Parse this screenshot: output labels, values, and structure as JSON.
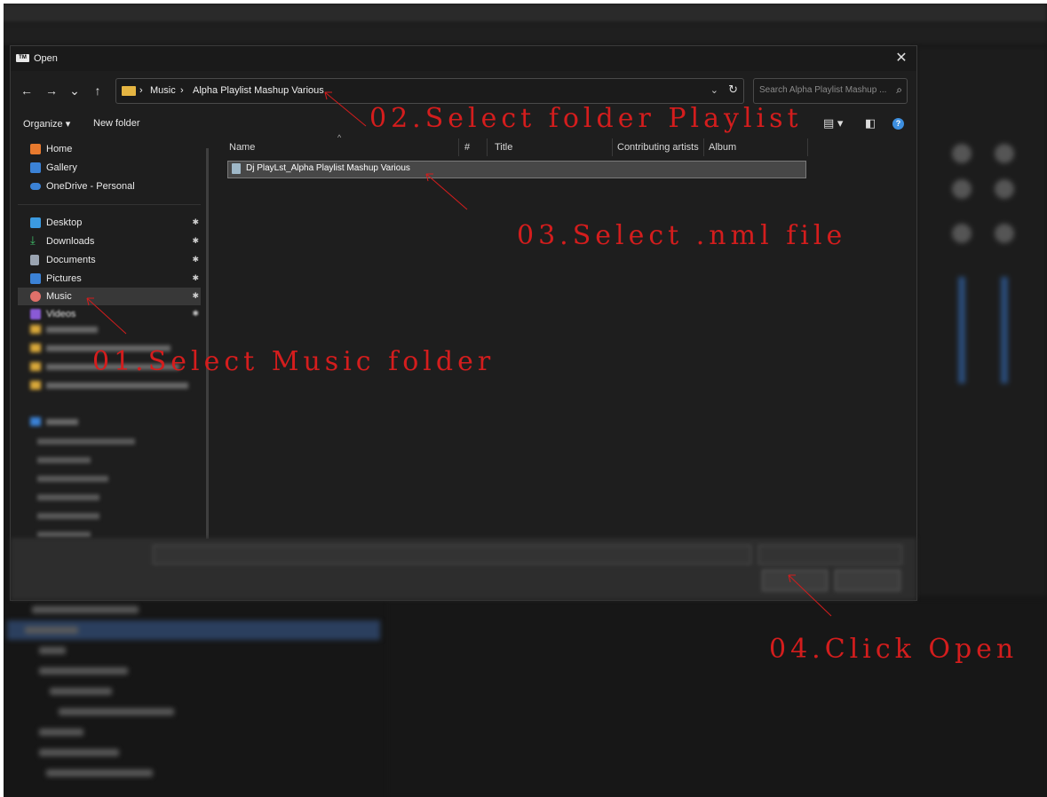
{
  "dialog": {
    "title": "Open",
    "app_badge": "TM",
    "close_glyph": "✕"
  },
  "nav": {
    "back": "←",
    "forward": "→",
    "recent": "⌄",
    "up": "↑",
    "breadcrumb": [
      "Music",
      "Alpha Playlist Mashup Various"
    ],
    "refresh": "↻",
    "dropdown": "⌄"
  },
  "search": {
    "placeholder": "Search Alpha Playlist Mashup ..."
  },
  "commands": {
    "organize": "Organize ▾",
    "new_folder": "New folder",
    "help": "?"
  },
  "sidebar": {
    "items": [
      {
        "label": "Home",
        "icon": "home-icon",
        "color": "#e87a2e"
      },
      {
        "label": "Gallery",
        "icon": "gallery-icon",
        "color": "#3b82d6"
      },
      {
        "label": "OneDrive - Personal",
        "icon": "cloud-icon",
        "color": "#3b82d6"
      },
      {
        "label": "Desktop",
        "icon": "desktop-icon",
        "color": "#3b9ae0",
        "pinned": true
      },
      {
        "label": "Downloads",
        "icon": "download-icon",
        "color": "#3fbf6a",
        "pinned": true
      },
      {
        "label": "Documents",
        "icon": "document-icon",
        "color": "#9aa4b1",
        "pinned": true
      },
      {
        "label": "Pictures",
        "icon": "pictures-icon",
        "color": "#3b82d6",
        "pinned": true
      },
      {
        "label": "Music",
        "icon": "music-icon",
        "color": "#e0706a",
        "pinned": true,
        "selected": true
      },
      {
        "label": "Videos",
        "icon": "videos-icon",
        "color": "#8a5ad6",
        "pinned": true
      }
    ],
    "pin_glyph": "📌"
  },
  "columns": {
    "name": "Name",
    "number": "#",
    "title": "Title",
    "artists": "Contributing artists",
    "album": "Album"
  },
  "files": [
    {
      "name": "Dj PlayLst_Alpha Playlist Mashup Various"
    }
  ],
  "annotations": {
    "step1": "01.Select Music folder",
    "step2": "02.Select folder Playlist",
    "step3": "03.Select .nml file",
    "step4": "04.Click Open"
  },
  "colors": {
    "annotation": "#d41d1d",
    "folder": "#e5b542",
    "accent": "#3d8fe0"
  }
}
